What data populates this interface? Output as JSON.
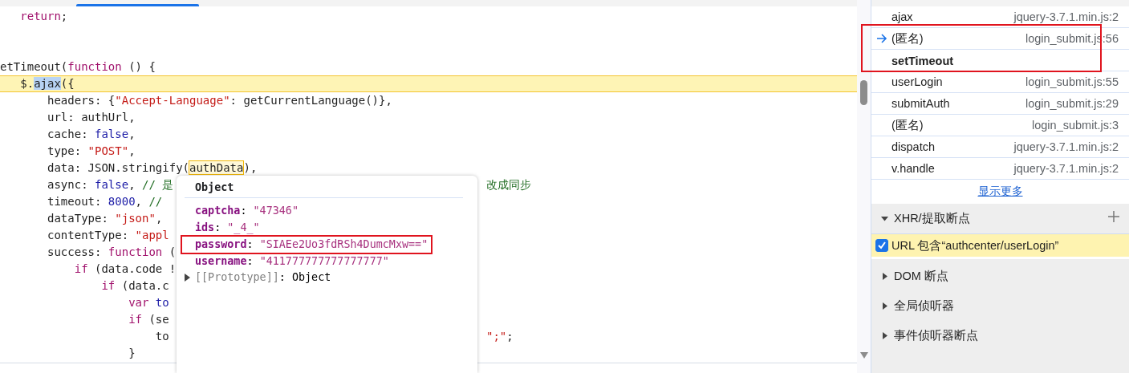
{
  "editor": {
    "lines": [
      {
        "kind": "indent",
        "children": [
          {
            "kind": "code",
            "tokens": [
              {
                "kind": "kw",
                "text": "return"
              },
              {
                "kind": "plain",
                "text": ";"
              }
            ]
          }
        ]
      },
      {
        "kind": "blank"
      },
      {
        "kind": "blank"
      },
      {
        "kind": "code",
        "tokens": [
          {
            "kind": "plain",
            "text": "etTimeout("
          },
          {
            "kind": "kw",
            "text": "function"
          },
          {
            "kind": "plain",
            "text": " () {"
          }
        ],
        "children": [
          {
            "kind": "code",
            "paused": true,
            "tokens": [
              {
                "kind": "plain",
                "text": "$."
              },
              {
                "kind": "sel",
                "text": "ajax"
              },
              {
                "kind": "plain",
                "text": "({"
              }
            ],
            "children": [
              {
                "kind": "code",
                "tokens": [
                  {
                    "kind": "plain",
                    "text": "headers: {"
                  },
                  {
                    "kind": "str",
                    "text": "\"Accept-Language\""
                  },
                  {
                    "kind": "plain",
                    "text": ": getCurrentLanguage()},"
                  }
                ]
              },
              {
                "kind": "code",
                "tokens": [
                  {
                    "kind": "plain",
                    "text": "url: authUrl,"
                  }
                ]
              },
              {
                "kind": "code",
                "tokens": [
                  {
                    "kind": "plain",
                    "text": "cache: "
                  },
                  {
                    "kind": "lit",
                    "text": "false"
                  },
                  {
                    "kind": "plain",
                    "text": ","
                  }
                ]
              },
              {
                "kind": "code",
                "tokens": [
                  {
                    "kind": "plain",
                    "text": "type: "
                  },
                  {
                    "kind": "str",
                    "text": "\"POST\""
                  },
                  {
                    "kind": "plain",
                    "text": ","
                  }
                ]
              },
              {
                "kind": "code",
                "tokens": [
                  {
                    "kind": "plain",
                    "text": "data: JSON.stringify("
                  },
                  {
                    "kind": "hover",
                    "text": "authData"
                  },
                  {
                    "kind": "plain",
                    "text": "),"
                  }
                ]
              },
              {
                "kind": "code",
                "tokens": [
                  {
                    "kind": "plain",
                    "text": "async: "
                  },
                  {
                    "kind": "lit",
                    "text": "false"
                  },
                  {
                    "kind": "plain",
                    "text": ", "
                  },
                  {
                    "kind": "com",
                    "text": "// 是"
                  }
                ],
                "right": [
                  {
                    "kind": "com",
                    "text": "改成同步"
                  }
                ]
              },
              {
                "kind": "code",
                "tokens": [
                  {
                    "kind": "plain",
                    "text": "timeout: "
                  },
                  {
                    "kind": "lit",
                    "text": "8000"
                  },
                  {
                    "kind": "plain",
                    "text": ", "
                  },
                  {
                    "kind": "com",
                    "text": "//"
                  }
                ]
              },
              {
                "kind": "code",
                "tokens": [
                  {
                    "kind": "plain",
                    "text": "dataType: "
                  },
                  {
                    "kind": "str",
                    "text": "\"json\""
                  },
                  {
                    "kind": "plain",
                    "text": ","
                  }
                ]
              },
              {
                "kind": "code",
                "tokens": [
                  {
                    "kind": "plain",
                    "text": "contentType: "
                  },
                  {
                    "kind": "str",
                    "text": "\"appl"
                  }
                ]
              },
              {
                "kind": "code",
                "tokens": [
                  {
                    "kind": "plain",
                    "text": "success: "
                  },
                  {
                    "kind": "kw",
                    "text": "function"
                  },
                  {
                    "kind": "plain",
                    "text": " ("
                  }
                ],
                "children": [
                  {
                    "kind": "code",
                    "tokens": [
                      {
                        "kind": "kw",
                        "text": "if"
                      },
                      {
                        "kind": "plain",
                        "text": " (data.code !"
                      }
                    ],
                    "children": [
                      {
                        "kind": "code",
                        "tokens": [
                          {
                            "kind": "kw",
                            "text": "if"
                          },
                          {
                            "kind": "plain",
                            "text": " (data.c"
                          }
                        ],
                        "children": [
                          {
                            "kind": "code",
                            "tokens": [
                              {
                                "kind": "kw",
                                "text": "var"
                              },
                              {
                                "kind": "lit",
                                "text": " to"
                              }
                            ]
                          },
                          {
                            "kind": "code",
                            "tokens": [
                              {
                                "kind": "kw",
                                "text": "if"
                              },
                              {
                                "kind": "plain",
                                "text": " (se"
                              }
                            ],
                            "children": [
                              {
                                "kind": "code",
                                "tokens": [
                                  {
                                    "kind": "plain",
                                    "text": "to"
                                  }
                                ],
                                "right": [
                                  {
                                    "kind": "str",
                                    "text": "\";\""
                                  },
                                  {
                                    "kind": "plain",
                                    "text": ";"
                                  }
                                ]
                              }
                            ]
                          },
                          {
                            "kind": "code",
                            "tokens": [
                              {
                                "kind": "plain",
                                "text": "}"
                              }
                            ]
                          }
                        ]
                      }
                    ]
                  }
                ]
              }
            ]
          }
        ]
      }
    ]
  },
  "popover": {
    "title": "Object",
    "properties": [
      {
        "name": "captcha",
        "sep": ":",
        "value": "\"47346\"",
        "boxed": false
      },
      {
        "name": "ids",
        "sep": ":",
        "value": "\"_4_\"",
        "boxed": false
      },
      {
        "name": "password",
        "sep": ":",
        "value": "\"SIAEe2Uo3fdRSh4DumcMxw==\"",
        "boxed": true
      },
      {
        "name": "username",
        "sep": ":",
        "value": "\"411777777777777777\"",
        "boxed": false
      }
    ],
    "prototype": {
      "name": "[[Prototype]]",
      "value": ": Object",
      "expanded": false
    }
  },
  "call_stack": {
    "frames": [
      {
        "kind": "frame",
        "name": "ajax",
        "location": "jquery-3.7.1.min.js:2",
        "current": false,
        "boxed": false
      },
      {
        "kind": "frame",
        "name": "(匿名)",
        "location": "login_submit.js:56",
        "current": true,
        "boxed": true
      },
      {
        "kind": "async",
        "name": "setTimeout",
        "boxed": true
      },
      {
        "kind": "frame",
        "name": "userLogin",
        "location": "login_submit.js:55",
        "current": false,
        "boxed": false
      },
      {
        "kind": "frame",
        "name": "submitAuth",
        "location": "login_submit.js:29",
        "current": false,
        "boxed": false
      },
      {
        "kind": "frame",
        "name": "(匿名)",
        "location": "login_submit.js:3",
        "current": false,
        "boxed": false
      },
      {
        "kind": "frame",
        "name": "dispatch",
        "location": "jquery-3.7.1.min.js:2",
        "current": false,
        "boxed": false
      },
      {
        "kind": "frame",
        "name": "v.handle",
        "location": "jquery-3.7.1.min.js:2",
        "current": false,
        "boxed": false
      }
    ],
    "show_more": "显示更多"
  },
  "sections": [
    {
      "title": "XHR/提取断点",
      "expanded": true,
      "breakpoints": [
        {
          "label": "URL 包含“authcenter/userLogin”",
          "checked": true,
          "hit": true
        }
      ]
    },
    {
      "title": "DOM 断点",
      "expanded": false
    },
    {
      "title": "全局侦听器",
      "expanded": false
    },
    {
      "title": "事件侦听器断点",
      "expanded": false
    }
  ]
}
